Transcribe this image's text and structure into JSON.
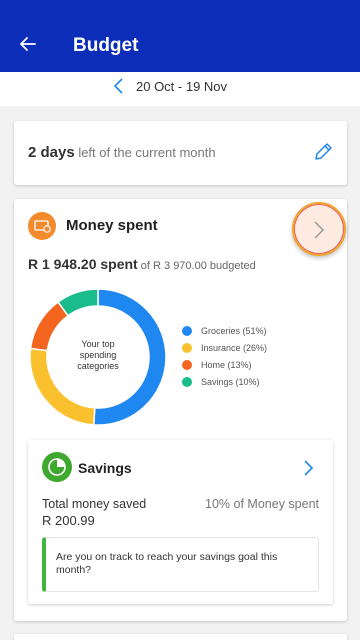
{
  "header": {
    "title": "Budget",
    "back_icon": "arrow-left-icon"
  },
  "period": {
    "range": "20 Oct - 19 Nov",
    "prev_icon": "chevron-left-icon"
  },
  "days_card": {
    "count": "2 days",
    "suffix": " left of the current month",
    "edit_icon": "pencil-icon"
  },
  "money_spent": {
    "title": "Money spent",
    "icon": "money-spent-icon",
    "spent_amount": "R 1 948.20 spent",
    "budget_text": " of R 3 970.00 budgeted",
    "chart_center_label": "Your top spending categories",
    "open_icon": "chevron-right-icon"
  },
  "chart_data": {
    "type": "pie",
    "categories": [
      "Groceries (51%)",
      "Insurance (26%)",
      "Home (13%)",
      "Savings (10%)"
    ],
    "values": [
      51,
      26,
      13,
      10
    ],
    "colors": [
      "#1e88f0",
      "#fbc02d",
      "#f4661f",
      "#1abc8c"
    ]
  },
  "savings": {
    "title": "Savings",
    "icon": "savings-icon",
    "label": "Total money saved",
    "amount": "R 200.99",
    "percent_text": "10% of Money spent",
    "tip": "Are you on track to reach your savings goal this month?",
    "open_icon": "chevron-right-icon"
  }
}
